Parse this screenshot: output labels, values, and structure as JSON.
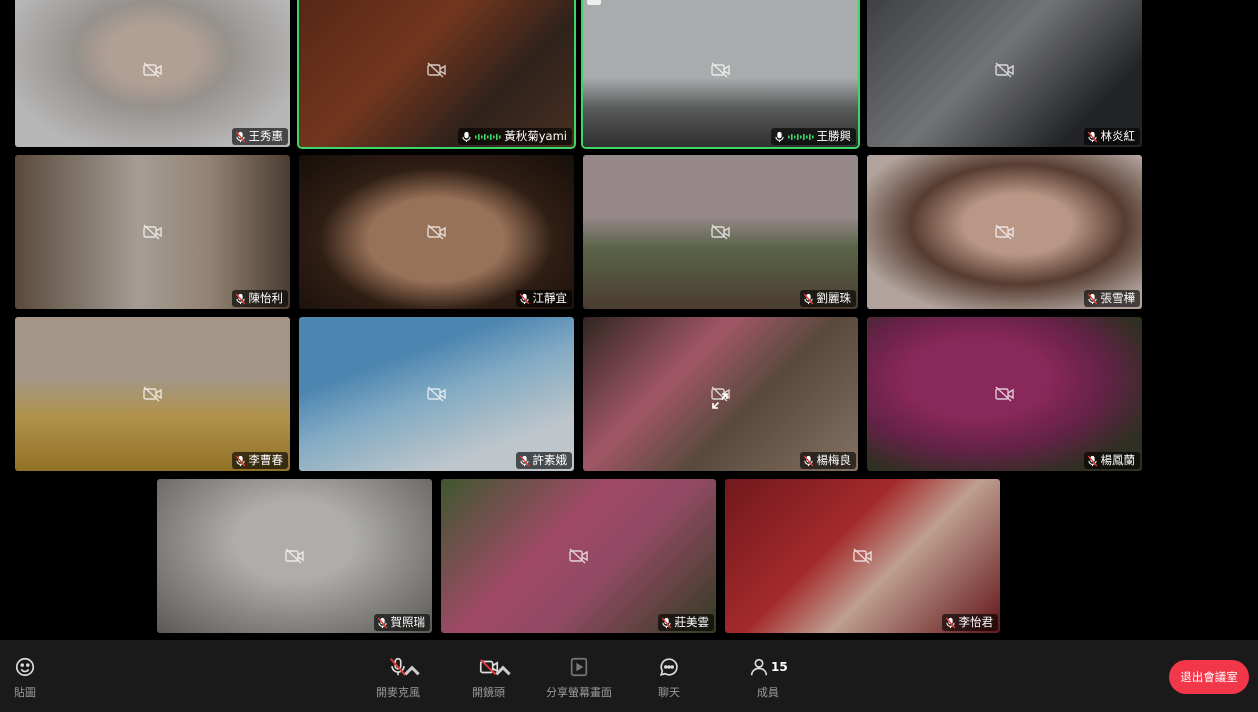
{
  "participants": [
    {
      "name": "王秀惠",
      "muted": true,
      "speaking": false
    },
    {
      "name": "黃秋菊yami",
      "muted": false,
      "speaking": true
    },
    {
      "name": "王勝興",
      "muted": false,
      "speaking": true
    },
    {
      "name": "林炎紅",
      "muted": true,
      "speaking": false
    },
    {
      "name": "陳怡利",
      "muted": true,
      "speaking": false
    },
    {
      "name": "江靜宜",
      "muted": true,
      "speaking": false
    },
    {
      "name": "劉麗珠",
      "muted": true,
      "speaking": false
    },
    {
      "name": "張雪樺",
      "muted": true,
      "speaking": false
    },
    {
      "name": "李曹春",
      "muted": true,
      "speaking": false
    },
    {
      "name": "許素娥",
      "muted": true,
      "speaking": false
    },
    {
      "name": "楊梅良",
      "muted": true,
      "speaking": false
    },
    {
      "name": "楊鳳蘭",
      "muted": true,
      "speaking": false
    },
    {
      "name": "賀照瑞",
      "muted": true,
      "speaking": false
    },
    {
      "name": "莊美雲",
      "muted": true,
      "speaking": false
    },
    {
      "name": "李怡君",
      "muted": true,
      "speaking": false
    }
  ],
  "toolbar": {
    "sticker_label": "貼圖",
    "mic_label": "開麥克風",
    "camera_label": "開鏡頭",
    "share_label": "分享螢幕畫面",
    "chat_label": "聊天",
    "members_label": "成員",
    "members_count": "15",
    "leave_label": "退出會議室"
  },
  "colors": {
    "speaking_border": "#3dd667",
    "leave_button": "#f2374b",
    "toolbar_bg": "#1a1a1a",
    "mic_muted": "#e53935"
  }
}
